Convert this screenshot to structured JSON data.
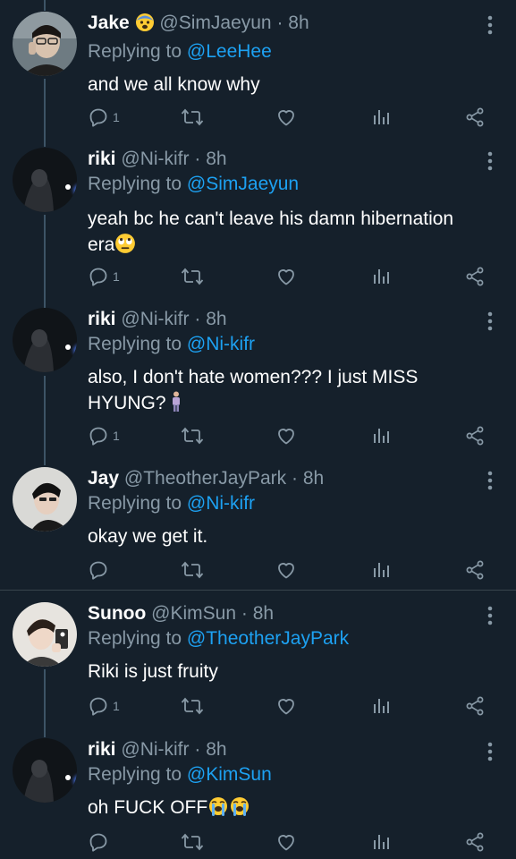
{
  "tweets": [
    {
      "name": "Jake",
      "handle": "@SimJaeyun",
      "dot": "·",
      "time": "8h",
      "reply_prefix": "Replying to ",
      "reply_to": "@LeeHee",
      "text": "and we all know why",
      "reply_count": "1",
      "avatar": "person-glasses-avatar",
      "name_emoji": "anxious-face-emoji"
    },
    {
      "name": "riki",
      "handle": "@Ni-kifr",
      "dot": "·",
      "time": "8h",
      "reply_prefix": "Replying to ",
      "reply_to": "@SimJaeyun",
      "text": "yeah bc he can't leave his damn hibernation era",
      "reply_count": "1",
      "avatar": "dark-room-light-avatar",
      "text_emoji": "rolling-eyes-emoji"
    },
    {
      "name": "riki",
      "handle": "@Ni-kifr",
      "dot": "·",
      "time": "8h",
      "reply_prefix": "Replying to ",
      "reply_to": "@Ni-kifr",
      "text": "also, I don't hate women??? I just MISS HYUNG?",
      "reply_count": "1",
      "avatar": "dark-room-light-avatar",
      "text_emoji": "person-standing-emoji"
    },
    {
      "name": "Jay",
      "handle": "@TheotherJayPark",
      "dot": "·",
      "time": "8h",
      "reply_prefix": "Replying to ",
      "reply_to": "@Ni-kifr",
      "text": "okay we get it.",
      "reply_count": "",
      "avatar": "person-dark-hair-avatar"
    },
    {
      "name": "Sunoo",
      "handle": "@KimSun",
      "dot": "·",
      "time": "8h",
      "reply_prefix": "Replying to ",
      "reply_to": "@TheotherJayPark",
      "text": "Riki is just fruity",
      "reply_count": "1",
      "avatar": "person-phone-avatar"
    },
    {
      "name": "riki",
      "handle": "@Ni-kifr",
      "dot": "·",
      "time": "8h",
      "reply_prefix": "Replying to ",
      "reply_to": "@KimSun",
      "text": "oh FUCK OFF",
      "reply_count": "",
      "avatar": "dark-room-light-avatar",
      "text_emoji": "crying-face-emoji"
    }
  ],
  "colors": {
    "background": "#15202b",
    "secondary_text": "#8899a6",
    "link": "#1da1f2",
    "thread_line": "#3d5466"
  }
}
